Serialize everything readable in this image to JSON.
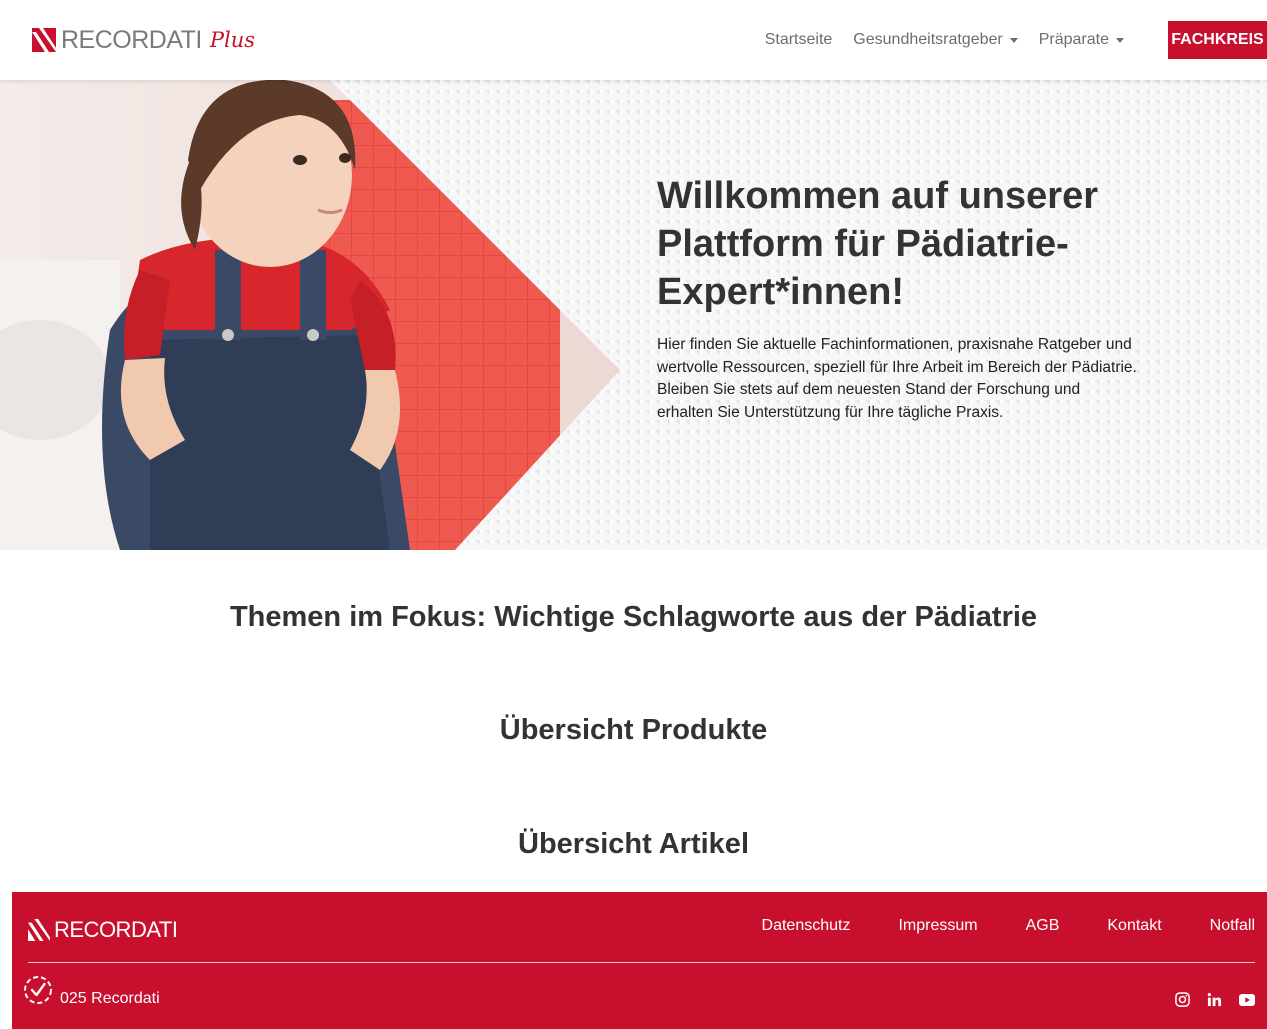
{
  "header": {
    "logo_text": "RECORDATI",
    "logo_plus": "Plus",
    "nav": {
      "startseite": "Startseite",
      "gesundheitsratgeber": "Gesundheitsratgeber",
      "praeparate": "Präparate"
    },
    "fachkreis": "FACHKREIS"
  },
  "hero": {
    "title": "Willkommen auf unserer Plattform für Pädiatrie-Expert*innen!",
    "text": "Hier finden Sie aktuelle Fachinformationen, praxisnahe Ratgeber und wertvolle Ressourcen, speziell für Ihre Arbeit im Bereich der Pädiatrie. Bleiben Sie stets auf dem neuesten Stand der Forschung und erhalten Sie Unterstützung für Ihre tägliche Praxis."
  },
  "sections": {
    "themen": "Themen im Fokus: Wichtige Schlagworte aus der Pädiatrie",
    "produkte": "Übersicht Produkte",
    "artikel": "Übersicht Artikel"
  },
  "footer": {
    "logo_text": "RECORDATI",
    "links": {
      "datenschutz": "Datenschutz",
      "impressum": "Impressum",
      "agb": "AGB",
      "kontakt": "Kontakt",
      "notfall": "Notfall"
    },
    "copyright": "025 Recordati",
    "socials": [
      "instagram-icon",
      "linkedin-icon",
      "youtube-icon"
    ]
  },
  "colors": {
    "brand_red": "#c8102e",
    "text_dark": "#333333",
    "nav_grey": "#6d6d6d"
  }
}
